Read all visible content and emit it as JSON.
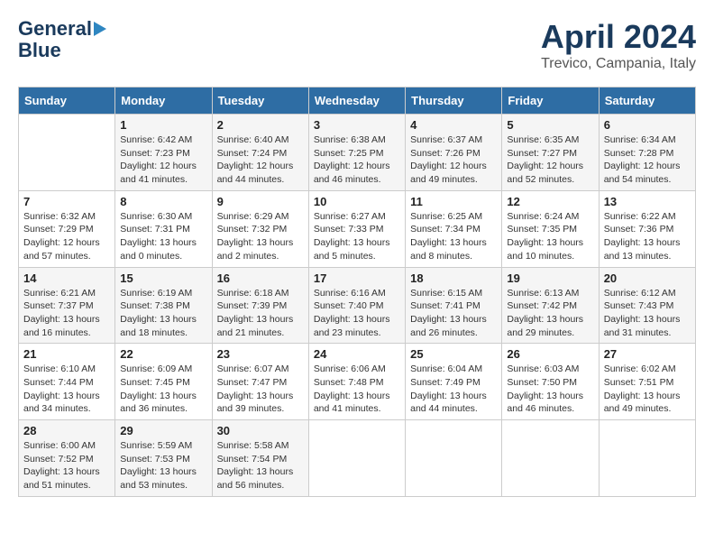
{
  "header": {
    "logo_line1": "General",
    "logo_line2": "Blue",
    "month": "April 2024",
    "location": "Trevico, Campania, Italy"
  },
  "days_of_week": [
    "Sunday",
    "Monday",
    "Tuesday",
    "Wednesday",
    "Thursday",
    "Friday",
    "Saturday"
  ],
  "weeks": [
    [
      {
        "day": null
      },
      {
        "day": "1",
        "sunrise": "6:42 AM",
        "sunset": "7:23 PM",
        "daylight": "12 hours and 41 minutes."
      },
      {
        "day": "2",
        "sunrise": "6:40 AM",
        "sunset": "7:24 PM",
        "daylight": "12 hours and 44 minutes."
      },
      {
        "day": "3",
        "sunrise": "6:38 AM",
        "sunset": "7:25 PM",
        "daylight": "12 hours and 46 minutes."
      },
      {
        "day": "4",
        "sunrise": "6:37 AM",
        "sunset": "7:26 PM",
        "daylight": "12 hours and 49 minutes."
      },
      {
        "day": "5",
        "sunrise": "6:35 AM",
        "sunset": "7:27 PM",
        "daylight": "12 hours and 52 minutes."
      },
      {
        "day": "6",
        "sunrise": "6:34 AM",
        "sunset": "7:28 PM",
        "daylight": "12 hours and 54 minutes."
      }
    ],
    [
      {
        "day": "7",
        "sunrise": "6:32 AM",
        "sunset": "7:29 PM",
        "daylight": "12 hours and 57 minutes."
      },
      {
        "day": "8",
        "sunrise": "6:30 AM",
        "sunset": "7:31 PM",
        "daylight": "13 hours and 0 minutes."
      },
      {
        "day": "9",
        "sunrise": "6:29 AM",
        "sunset": "7:32 PM",
        "daylight": "13 hours and 2 minutes."
      },
      {
        "day": "10",
        "sunrise": "6:27 AM",
        "sunset": "7:33 PM",
        "daylight": "13 hours and 5 minutes."
      },
      {
        "day": "11",
        "sunrise": "6:25 AM",
        "sunset": "7:34 PM",
        "daylight": "13 hours and 8 minutes."
      },
      {
        "day": "12",
        "sunrise": "6:24 AM",
        "sunset": "7:35 PM",
        "daylight": "13 hours and 10 minutes."
      },
      {
        "day": "13",
        "sunrise": "6:22 AM",
        "sunset": "7:36 PM",
        "daylight": "13 hours and 13 minutes."
      }
    ],
    [
      {
        "day": "14",
        "sunrise": "6:21 AM",
        "sunset": "7:37 PM",
        "daylight": "13 hours and 16 minutes."
      },
      {
        "day": "15",
        "sunrise": "6:19 AM",
        "sunset": "7:38 PM",
        "daylight": "13 hours and 18 minutes."
      },
      {
        "day": "16",
        "sunrise": "6:18 AM",
        "sunset": "7:39 PM",
        "daylight": "13 hours and 21 minutes."
      },
      {
        "day": "17",
        "sunrise": "6:16 AM",
        "sunset": "7:40 PM",
        "daylight": "13 hours and 23 minutes."
      },
      {
        "day": "18",
        "sunrise": "6:15 AM",
        "sunset": "7:41 PM",
        "daylight": "13 hours and 26 minutes."
      },
      {
        "day": "19",
        "sunrise": "6:13 AM",
        "sunset": "7:42 PM",
        "daylight": "13 hours and 29 minutes."
      },
      {
        "day": "20",
        "sunrise": "6:12 AM",
        "sunset": "7:43 PM",
        "daylight": "13 hours and 31 minutes."
      }
    ],
    [
      {
        "day": "21",
        "sunrise": "6:10 AM",
        "sunset": "7:44 PM",
        "daylight": "13 hours and 34 minutes."
      },
      {
        "day": "22",
        "sunrise": "6:09 AM",
        "sunset": "7:45 PM",
        "daylight": "13 hours and 36 minutes."
      },
      {
        "day": "23",
        "sunrise": "6:07 AM",
        "sunset": "7:47 PM",
        "daylight": "13 hours and 39 minutes."
      },
      {
        "day": "24",
        "sunrise": "6:06 AM",
        "sunset": "7:48 PM",
        "daylight": "13 hours and 41 minutes."
      },
      {
        "day": "25",
        "sunrise": "6:04 AM",
        "sunset": "7:49 PM",
        "daylight": "13 hours and 44 minutes."
      },
      {
        "day": "26",
        "sunrise": "6:03 AM",
        "sunset": "7:50 PM",
        "daylight": "13 hours and 46 minutes."
      },
      {
        "day": "27",
        "sunrise": "6:02 AM",
        "sunset": "7:51 PM",
        "daylight": "13 hours and 49 minutes."
      }
    ],
    [
      {
        "day": "28",
        "sunrise": "6:00 AM",
        "sunset": "7:52 PM",
        "daylight": "13 hours and 51 minutes."
      },
      {
        "day": "29",
        "sunrise": "5:59 AM",
        "sunset": "7:53 PM",
        "daylight": "13 hours and 53 minutes."
      },
      {
        "day": "30",
        "sunrise": "5:58 AM",
        "sunset": "7:54 PM",
        "daylight": "13 hours and 56 minutes."
      },
      {
        "day": null
      },
      {
        "day": null
      },
      {
        "day": null
      },
      {
        "day": null
      }
    ]
  ],
  "labels": {
    "sunrise": "Sunrise:",
    "sunset": "Sunset:",
    "daylight": "Daylight:"
  }
}
